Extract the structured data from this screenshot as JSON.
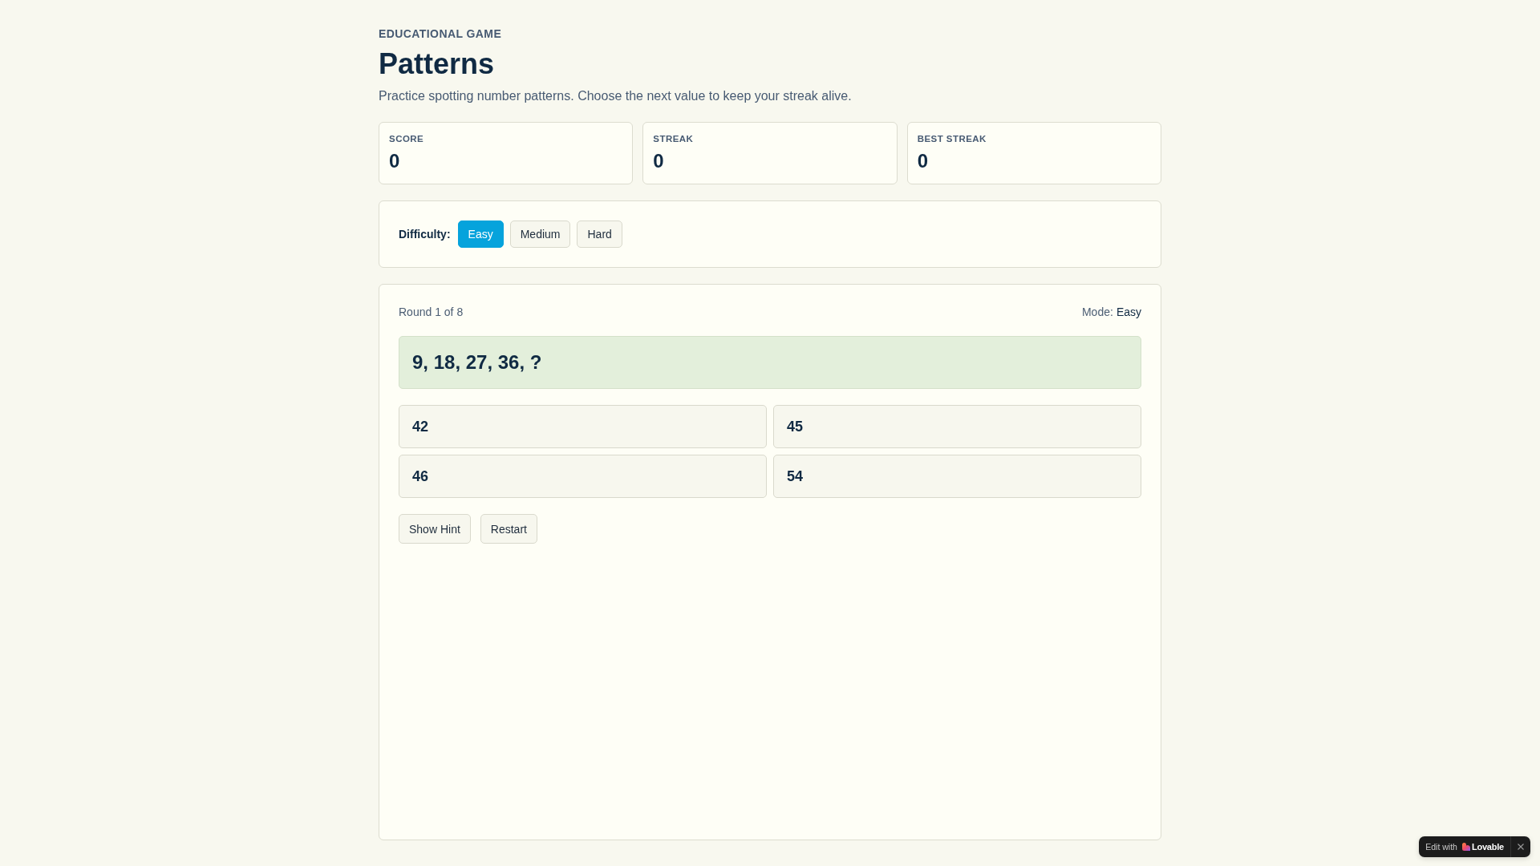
{
  "header": {
    "eyebrow": "EDUCATIONAL GAME",
    "title": "Patterns",
    "description": "Practice spotting number patterns. Choose the next value to keep your streak alive."
  },
  "stats": [
    {
      "label": "SCORE",
      "value": "0"
    },
    {
      "label": "STREAK",
      "value": "0"
    },
    {
      "label": "BEST STREAK",
      "value": "0"
    }
  ],
  "difficulty": {
    "label": "Difficulty:",
    "options": [
      {
        "label": "Easy",
        "selected": true
      },
      {
        "label": "Medium",
        "selected": false
      },
      {
        "label": "Hard",
        "selected": false
      }
    ]
  },
  "game": {
    "round": "Round 1 of 8",
    "mode_label": "Mode:",
    "mode_value": "Easy",
    "sequence": "9, 18, 27, 36, ?",
    "choices": [
      "42",
      "45",
      "46",
      "54"
    ],
    "actions": [
      "Show Hint",
      "Restart"
    ]
  },
  "badge": {
    "text": "Edit with",
    "brand": "Lovable"
  }
}
